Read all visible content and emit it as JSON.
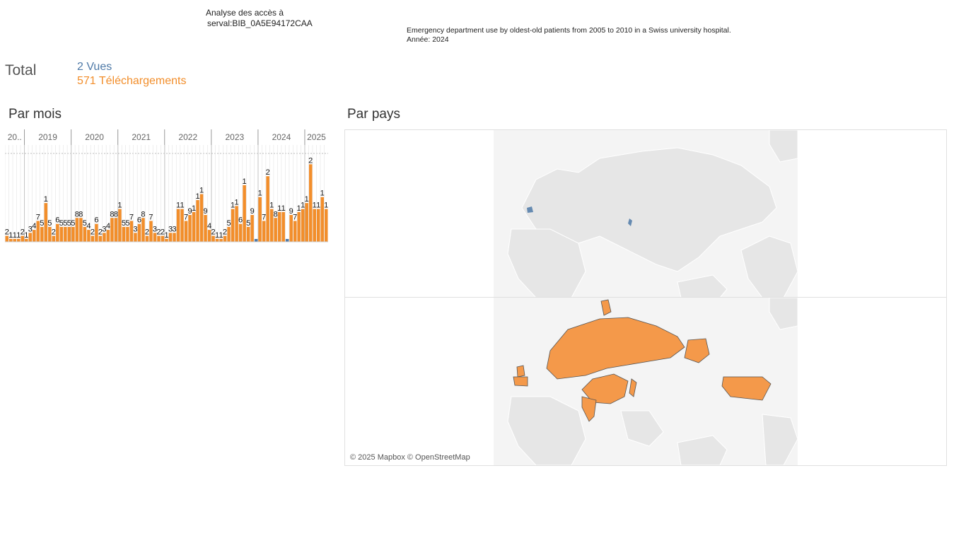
{
  "header": {
    "analysis_line1": "Analyse des accès à",
    "analysis_line2": "serval:BIB_0A5E94172CAA",
    "publication_title": "Emergency department use by oldest-old patients from 2005 to 2010 in a Swiss university hospital.",
    "publication_year": "Année: 2024"
  },
  "totals": {
    "label": "Total",
    "views": "2 Vues",
    "downloads": "571 Téléchargements"
  },
  "sections": {
    "by_month": "Par mois",
    "by_country": "Par pays"
  },
  "colors": {
    "views": "#4e79a7",
    "downloads": "#f28e2b",
    "map_base": "#e6e6e6"
  },
  "chart_data": [
    {
      "type": "bar",
      "title": "Par mois",
      "year_labels": [
        "20..",
        "2019",
        "2020",
        "2021",
        "2022",
        "2023",
        "2024",
        "2025"
      ],
      "series": [
        {
          "name": "Téléchargements",
          "values": [
            2,
            1,
            1,
            1,
            2,
            1,
            3,
            4,
            7,
            5,
            13,
            5,
            2,
            6,
            5,
            5,
            5,
            5,
            8,
            8,
            5,
            4,
            2,
            6,
            2,
            3,
            4,
            8,
            8,
            11,
            5,
            5,
            7,
            3,
            6,
            8,
            2,
            7,
            3,
            2,
            2,
            1,
            3,
            3,
            11,
            11,
            7,
            9,
            10,
            14,
            16,
            9,
            4,
            2,
            1,
            1,
            2,
            5,
            11,
            12,
            6,
            19,
            5,
            9,
            0,
            15,
            7,
            22,
            11,
            8,
            10,
            10,
            0,
            9,
            7,
            10,
            11,
            13,
            26,
            11,
            11,
            15,
            11
          ],
          "labels": [
            "2",
            "1",
            "1",
            "1",
            "2",
            "1",
            "3",
            "4",
            "7",
            "5",
            "1",
            "5",
            "2",
            "6",
            "5",
            "5",
            "5",
            "5",
            "8",
            "8",
            "5",
            "4",
            "2",
            "6",
            "2",
            "3",
            "4",
            "8",
            "8",
            "1",
            "5",
            "5",
            "7",
            "3",
            "6",
            "8",
            "2",
            "7",
            "3",
            "2",
            "2",
            "1",
            "3",
            "3",
            "1",
            "1",
            "7",
            "9",
            "1",
            "1",
            "1",
            "9",
            "4",
            "2",
            "1",
            "1",
            "2",
            "5",
            "1",
            "1",
            "6",
            "1",
            "5",
            "9",
            "",
            "1",
            "7",
            "2",
            "1",
            "8",
            "1",
            "1",
            "",
            "9",
            "7",
            "1",
            "1",
            "1",
            "2",
            "1",
            "1",
            "1",
            "1"
          ]
        },
        {
          "name": "Vues",
          "values": [
            0,
            0,
            0,
            0,
            0,
            0,
            0,
            0,
            0,
            0,
            0,
            0,
            0,
            0,
            0,
            0,
            0,
            0,
            0,
            0,
            0,
            0,
            0,
            0,
            0,
            0,
            0,
            0,
            0,
            0,
            0,
            0,
            0,
            0,
            0,
            0,
            0,
            0,
            0,
            0,
            0,
            0,
            0,
            0,
            0,
            0,
            0,
            0,
            0,
            0,
            0,
            0,
            0,
            0,
            0,
            0,
            0,
            0,
            0,
            0,
            0,
            0,
            0,
            0,
            1,
            0,
            0,
            0,
            0,
            0,
            0,
            0,
            1,
            0,
            0,
            0,
            0,
            0,
            0,
            0,
            0,
            0,
            0
          ]
        }
      ]
    }
  ],
  "map": {
    "attribution": "© 2025 Mapbox © OpenStreetMap",
    "views_countries": [
      "France",
      "Japan"
    ],
    "downloads_countries": [
      "United States",
      "Russia",
      "China",
      "India",
      "France",
      "United Kingdom",
      "Ireland",
      "Spain",
      "Portugal",
      "Japan",
      "Greenland",
      "Alaska"
    ]
  }
}
